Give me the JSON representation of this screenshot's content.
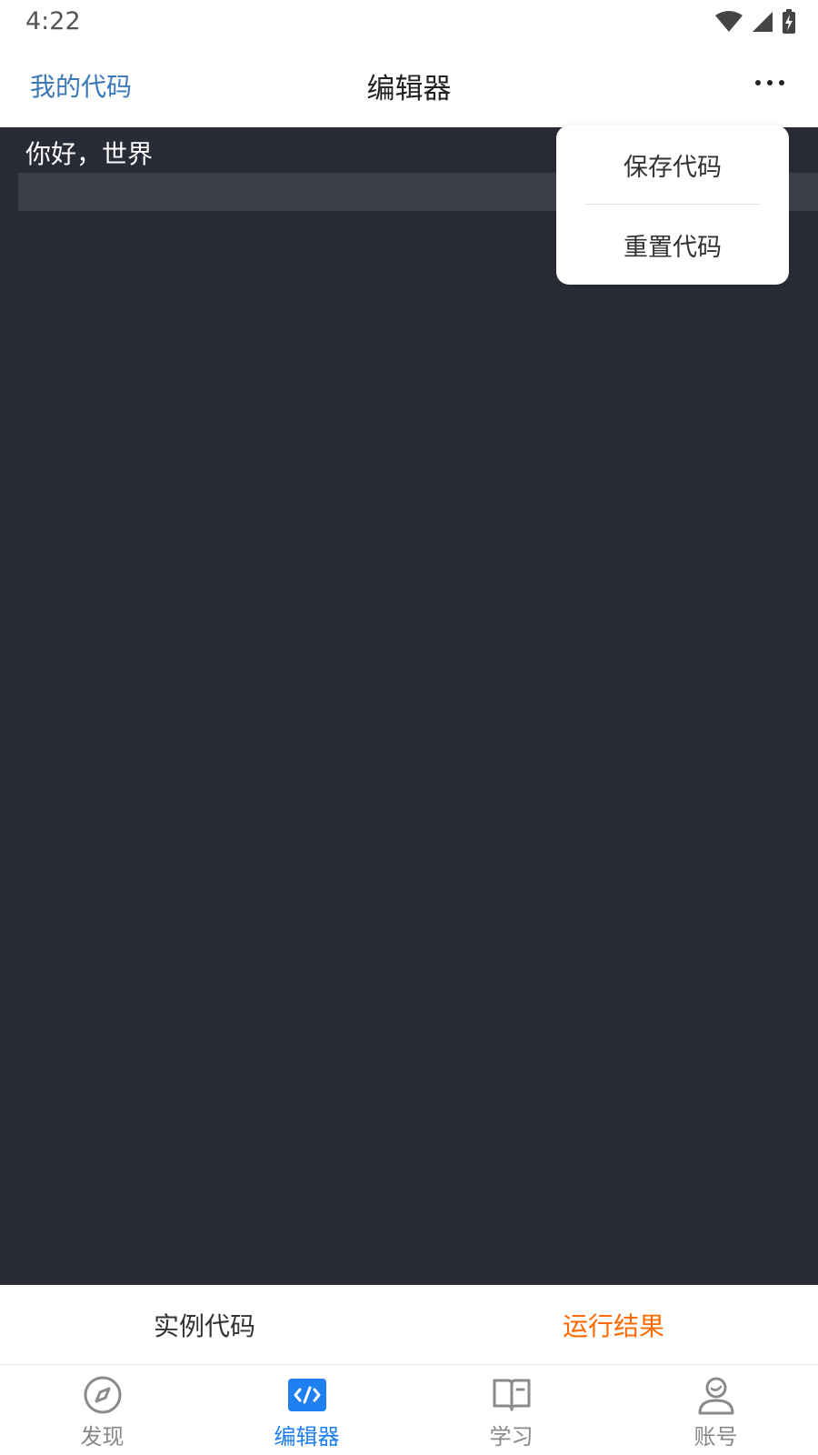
{
  "status_bar": {
    "time": "4:22",
    "icons": [
      "wifi-icon",
      "signal-icon",
      "battery-charging-icon"
    ]
  },
  "header": {
    "left_link": "我的代码",
    "title": "编辑器",
    "more_icon": "more-horizontal-icon"
  },
  "editor": {
    "lines": [
      "你好，世界"
    ]
  },
  "menu": {
    "items": [
      {
        "label": "保存代码"
      },
      {
        "label": "重置代码"
      }
    ]
  },
  "code_tabs": {
    "example_label": "实例代码",
    "result_label": "运行结果"
  },
  "bottom_nav": {
    "items": [
      {
        "label": "发现",
        "icon": "compass-icon",
        "active": false
      },
      {
        "label": "编辑器",
        "icon": "code-icon",
        "active": true
      },
      {
        "label": "学习",
        "icon": "book-icon",
        "active": false
      },
      {
        "label": "账号",
        "icon": "user-icon",
        "active": false
      }
    ]
  },
  "colors": {
    "accent_blue": "#1e7ff0",
    "header_link": "#3a78b8",
    "run_result": "#ff6a00",
    "editor_bg": "#292b36",
    "editor_active_line": "#3d404b"
  }
}
